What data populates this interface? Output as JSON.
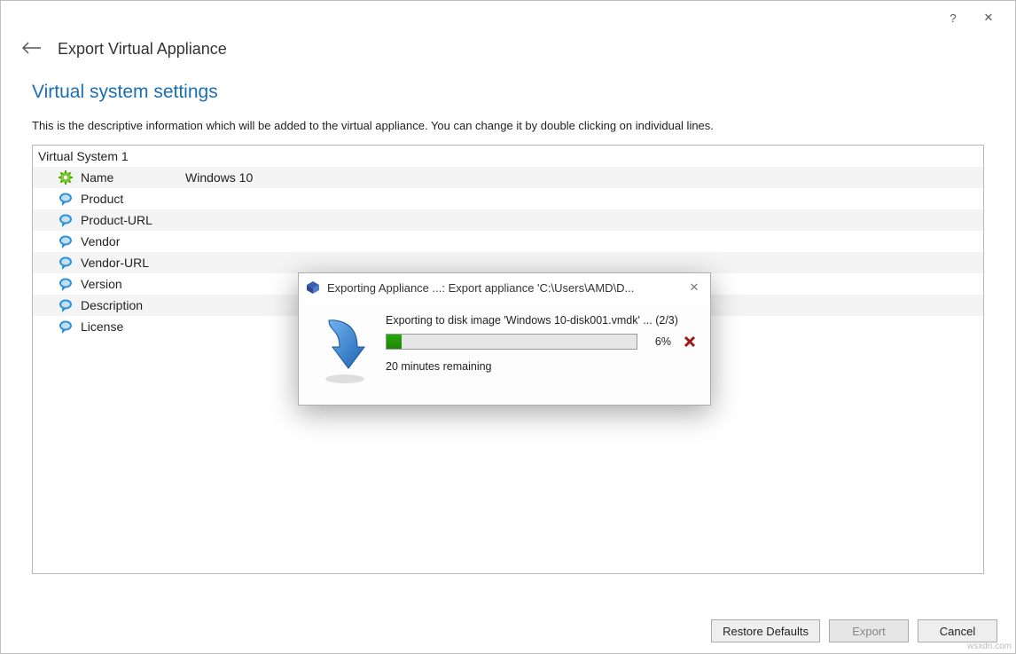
{
  "titlebar": {
    "help": "?",
    "close": "✕"
  },
  "wizard": {
    "title": "Export Virtual Appliance",
    "section_title": "Virtual system settings",
    "description": "This is the descriptive information which will be added to the virtual appliance. You can change it by double clicking on individual lines."
  },
  "settings": {
    "system_label": "Virtual System 1",
    "rows": [
      {
        "label": "Name",
        "value": "Windows 10",
        "icon": "gear"
      },
      {
        "label": "Product",
        "value": "",
        "icon": "bubble"
      },
      {
        "label": "Product-URL",
        "value": "",
        "icon": "bubble"
      },
      {
        "label": "Vendor",
        "value": "",
        "icon": "bubble"
      },
      {
        "label": "Vendor-URL",
        "value": "",
        "icon": "bubble"
      },
      {
        "label": "Version",
        "value": "",
        "icon": "bubble"
      },
      {
        "label": "Description",
        "value": "",
        "icon": "bubble"
      },
      {
        "label": "License",
        "value": "",
        "icon": "bubble"
      }
    ]
  },
  "buttons": {
    "restore": "Restore Defaults",
    "export": "Export",
    "cancel": "Cancel"
  },
  "dialog": {
    "title": "Exporting Appliance ...: Export appliance 'C:\\Users\\AMD\\D...",
    "status": "Exporting to disk image 'Windows 10-disk001.vmdk' ... (2/3)",
    "percent_text": "6%",
    "percent_value": 6,
    "remaining": "20 minutes remaining"
  },
  "watermark": "wsxdn.com"
}
